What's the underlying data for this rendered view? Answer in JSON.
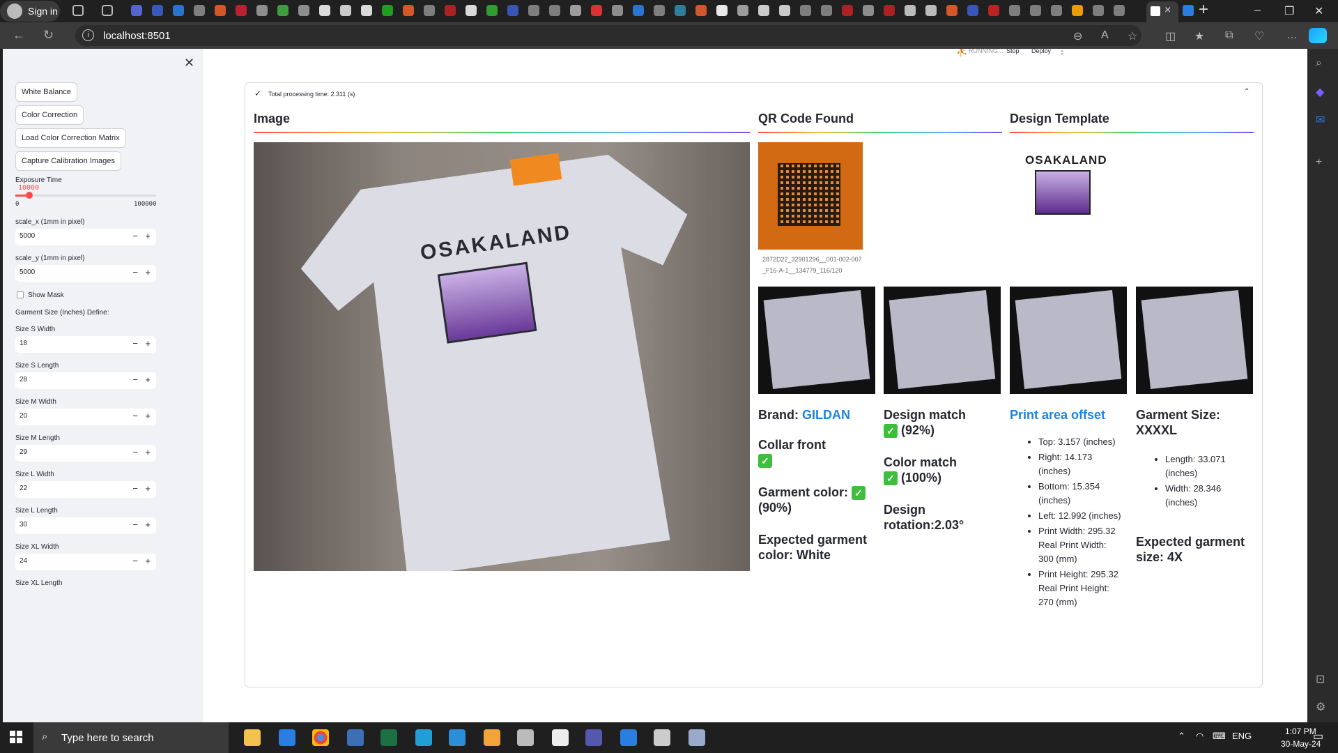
{
  "browser": {
    "signin_label": "Sign in",
    "url": "localhost:8501"
  },
  "app_header": {
    "status": "RUNNING...",
    "stop_label": "Stop",
    "deploy_label": "Deploy"
  },
  "sidebar": {
    "buttons": [
      "White Balance",
      "Color Correction",
      "Load Color Correction Matrix",
      "Capture Calibration Images"
    ],
    "exposure": {
      "label": "Exposure Time",
      "value": "10000",
      "min": "0",
      "max": "100000",
      "fraction": 0.1
    },
    "scale_x": {
      "label": "scale_x (1mm in pixel)",
      "value": "5000"
    },
    "scale_y": {
      "label": "scale_y (1mm in pixel)",
      "value": "5000"
    },
    "show_mask": "Show Mask",
    "garment_define": "Garment Size (Inches) Define:",
    "sizes": [
      {
        "label": "Size S Width",
        "value": "18"
      },
      {
        "label": "Size S Length",
        "value": "28"
      },
      {
        "label": "Size M Width",
        "value": "20"
      },
      {
        "label": "Size M Length",
        "value": "29"
      },
      {
        "label": "Size L Width",
        "value": "22"
      },
      {
        "label": "Size L Length",
        "value": "30"
      },
      {
        "label": "Size XL Width",
        "value": "24"
      }
    ],
    "last_label": "Size XL Length"
  },
  "main": {
    "processing": "Total processing time: 2.311 (s)",
    "col_image": "Image",
    "col_qr": "QR Code Found",
    "col_template": "Design Template",
    "qr_caption": "2872D22_32901296__001-002-007_F16-A-1__134779_116/120",
    "brand_label": "Brand: ",
    "brand_value": "GILDAN",
    "collar": "Collar front",
    "garment_color": "Garment color:",
    "garment_color_pct": "(90%)",
    "expected_color": "Expected garment color: White",
    "design_match": "Design match",
    "design_match_pct": "(92%)",
    "color_match": "Color match",
    "color_match_pct": "(100%)",
    "design_rotation": "Design rotation:2.03°",
    "print_area_title": "Print area offset",
    "print_area": [
      "Top: 3.157 (inches)",
      "Right: 14.173 (inches)",
      "Bottom: 15.354 (inches)",
      "Left: 12.992 (inches)",
      "Print Width: 295.32 Real Print Width: 300 (mm)",
      "Print Height: 295.32 Real Print Height: 270 (mm)"
    ],
    "garment_size": "Garment Size: XXXXL",
    "garment_dims": [
      "Length: 33.071 (inches)",
      "Width: 28.346 (inches)"
    ],
    "expected_size": "Expected garment size: 4X",
    "template_text": "OSAKALAND"
  },
  "taskbar": {
    "search_placeholder": "Type here to search",
    "lang": "ENG",
    "time": "1:07 PM",
    "date": "30-May-24"
  }
}
